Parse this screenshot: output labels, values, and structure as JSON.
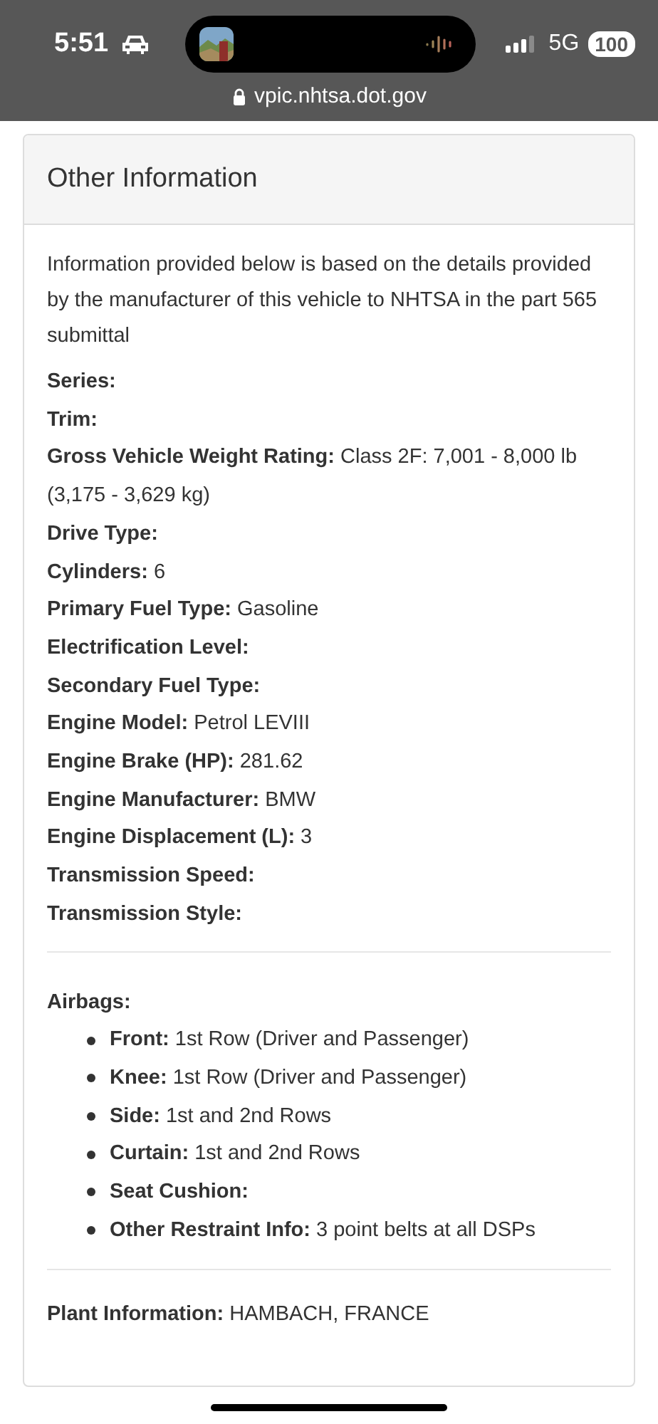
{
  "status_bar": {
    "time": "5:51",
    "network": "5G",
    "battery": "100",
    "url": "vpic.nhtsa.dot.gov"
  },
  "card": {
    "title": "Other Information",
    "intro": "Information provided below is based on the details provided by the manufacturer of this vehicle to NHTSA in the part 565 submittal",
    "fields": [
      {
        "label": "Series:"
      },
      {
        "label": "Trim:"
      },
      {
        "label": "Gross Vehicle Weight Rating:",
        "value": "Class 2F: 7,001 - 8,000 lb (3,175 - 3,629 kg)"
      },
      {
        "label": "Drive Type:"
      },
      {
        "label": "Cylinders:",
        "value": "6"
      },
      {
        "label": "Primary Fuel Type:",
        "value": "Gasoline"
      },
      {
        "label": "Electrification Level:"
      },
      {
        "label": "Secondary Fuel Type:"
      },
      {
        "label": "Engine Model:",
        "value": "Petrol LEVIII"
      },
      {
        "label": "Engine Brake (HP):",
        "value": "281.62"
      },
      {
        "label": "Engine Manufacturer:",
        "value": "BMW"
      },
      {
        "label": "Engine Displacement (L):",
        "value": "3"
      },
      {
        "label": "Transmission Speed:"
      },
      {
        "label": "Transmission Style:"
      }
    ],
    "airbags": {
      "label": "Airbags:",
      "items": [
        {
          "label": "Front:",
          "value": "1st Row (Driver and Passenger)"
        },
        {
          "label": "Knee:",
          "value": "1st Row (Driver and Passenger)"
        },
        {
          "label": "Side:",
          "value": "1st and 2nd Rows"
        },
        {
          "label": "Curtain:",
          "value": "1st and 2nd Rows"
        },
        {
          "label": "Seat Cushion:"
        },
        {
          "label": "Other Restraint Info:",
          "value": "3 point belts at all DSPs"
        }
      ]
    },
    "plant": {
      "label": "Plant Information:",
      "value": "HAMBACH, FRANCE"
    }
  }
}
